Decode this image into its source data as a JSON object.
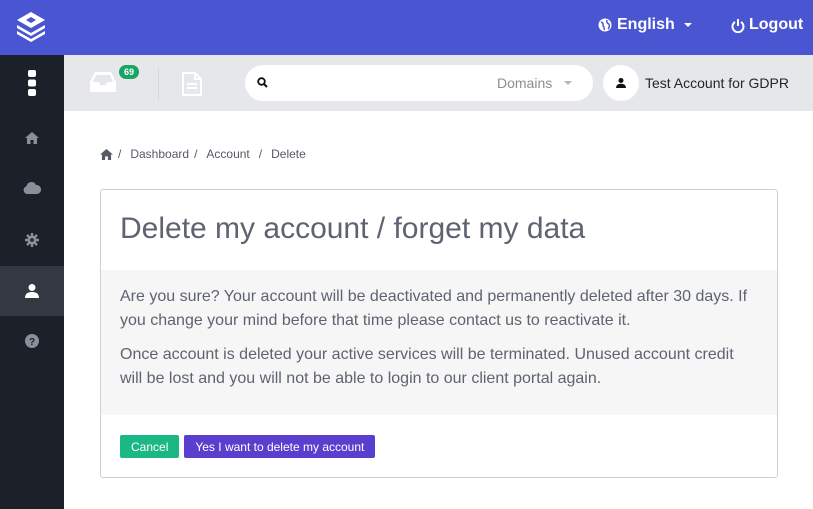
{
  "topbar": {
    "language": "English",
    "logout": "Logout"
  },
  "sidebar": {
    "items": [
      {
        "icon": "home-icon"
      },
      {
        "icon": "cloud-icon"
      },
      {
        "icon": "gear-icon"
      },
      {
        "icon": "user-icon",
        "active": true
      },
      {
        "icon": "help-icon"
      }
    ]
  },
  "subbar": {
    "inbox_count": "69",
    "search_placeholder": "",
    "search_scope": "Domains",
    "account_name": "Test Account for GDPR"
  },
  "breadcrumb": {
    "items": [
      "Dashboard",
      "Account",
      "Delete"
    ]
  },
  "card": {
    "title": "Delete my account / forget my data",
    "paragraphs": [
      "Are you sure? Your account will be deactivated and permanently deleted after 30 days. If you change your mind before that time please contact us to reactivate it.",
      "Once account is deleted your active services will be terminated. Unused account credit will be lost and you will not be able to login to our client portal again."
    ],
    "cancel_label": "Cancel",
    "confirm_label": "Yes I want to delete my account"
  },
  "colors": {
    "brand": "#4a55d1",
    "sidebar": "#1c2029",
    "cancel": "#1bb784",
    "danger": "#5a3fcf",
    "badge": "#1aa567"
  }
}
